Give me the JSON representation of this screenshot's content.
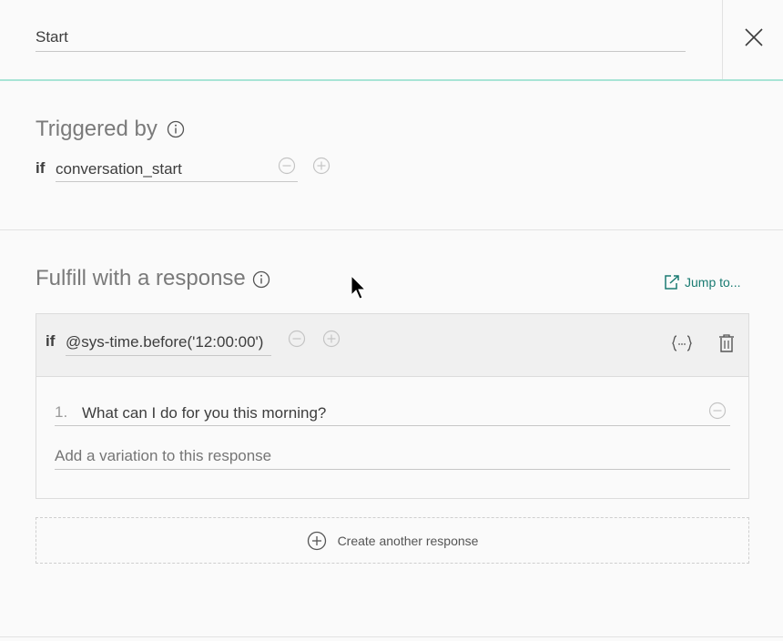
{
  "header": {
    "node_name": "Start"
  },
  "triggered": {
    "heading": "Triggered by",
    "if_label": "if",
    "condition": "conversation_start"
  },
  "fulfill": {
    "heading": "Fulfill with a response",
    "jump_label": "Jump to...",
    "response": {
      "if_label": "if",
      "condition": "@sys-time.before('12:00:00')",
      "variations": [
        {
          "number": "1.",
          "text": "What can I do for you this morning?"
        }
      ],
      "add_variation_placeholder": "Add a variation to this response"
    },
    "create_another_label": "Create another response"
  },
  "icons": {
    "close": "close-icon",
    "info": "info-icon",
    "minus": "minus-circle-icon",
    "plus": "plus-circle-icon",
    "jump": "jump-to-icon",
    "json_editor": "json-braces-icon",
    "delete": "trash-icon",
    "create": "plus-circle-icon"
  },
  "colors": {
    "accent_teal": "#1a7b72",
    "header_border": "#a8e4d6"
  }
}
